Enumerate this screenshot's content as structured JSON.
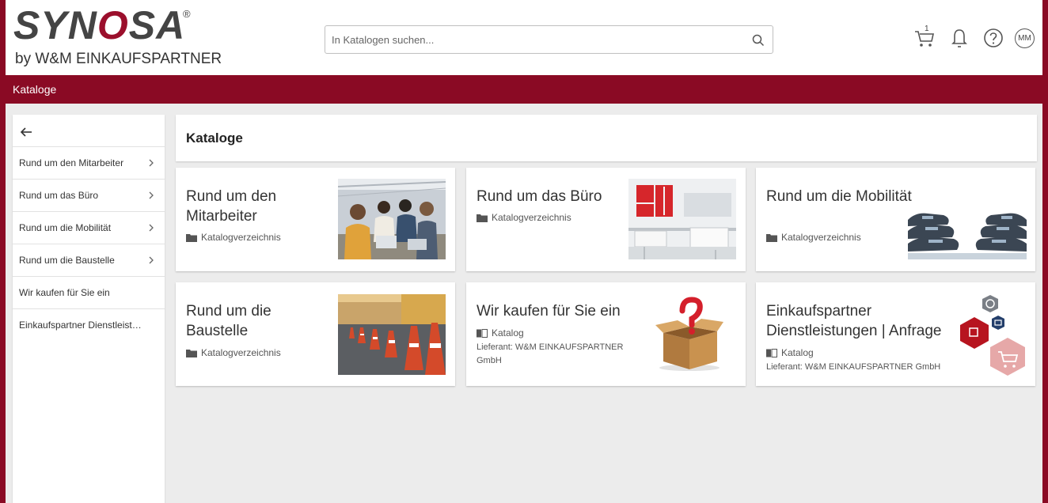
{
  "header": {
    "logo_main_pre": "SYN",
    "logo_main_o": "O",
    "logo_main_post": "SA",
    "logo_reg": "®",
    "logo_sub": "by W&M EINKAUFSPARTNER",
    "search_placeholder": "In Katalogen suchen...",
    "cart_count": "1",
    "avatar": "MM"
  },
  "titlebar": {
    "label": "Kataloge"
  },
  "sidebar": {
    "items": [
      {
        "label": "Rund um den Mitarbeiter",
        "has_children": true
      },
      {
        "label": "Rund um das Büro",
        "has_children": true
      },
      {
        "label": "Rund um die Mobilität",
        "has_children": true
      },
      {
        "label": "Rund um die Baustelle",
        "has_children": true
      },
      {
        "label": "Wir kaufen für Sie ein",
        "has_children": false
      },
      {
        "label": "Einkaufspartner Dienstleistun...",
        "has_children": false
      }
    ]
  },
  "main": {
    "heading": "Kataloge",
    "cards": [
      {
        "title": "Rund um den Mitarbeiter",
        "type": "Katalogverzeichnis"
      },
      {
        "title": "Rund um das Büro",
        "type": "Katalogverzeichnis"
      },
      {
        "title": "Rund um die Mobilität",
        "type": "Katalogverzeichnis"
      },
      {
        "title": "Rund um die Baustelle",
        "type": "Katalogverzeichnis"
      },
      {
        "title": "Wir kaufen für Sie ein",
        "type": "Katalog",
        "supplier": "Lieferant: W&M EINKAUFSPARTNER GmbH"
      },
      {
        "title": "Einkaufspartner Dienstleistungen | Anfrage",
        "type": "Katalog",
        "supplier": "Lieferant: W&M EINKAUFSPARTNER GmbH"
      }
    ]
  },
  "colors": {
    "brand": "#8a0a24",
    "background": "#ececec"
  }
}
